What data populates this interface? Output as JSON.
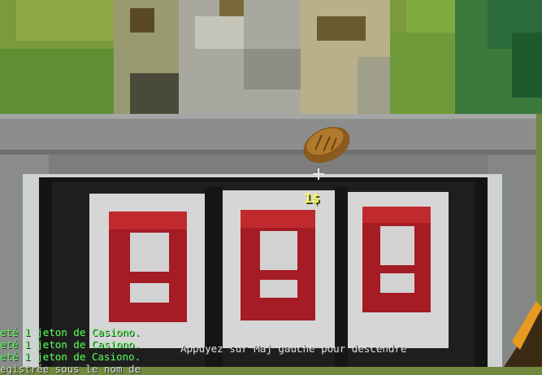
{
  "hud": {
    "price_label": "1$",
    "sneak_hint": "Appuyez sur Maj gauche pour descendre"
  },
  "chat": [
    {
      "text": "eté 1 jeton de Casiono.",
      "color": "#55ff55"
    },
    {
      "text": "eté 1 jeton de Casiono.",
      "color": "#55ff55"
    },
    {
      "text": "eté 1 jeton de Casiono.",
      "color": "#55ff55"
    },
    {
      "text": "egistrée sous le nom de",
      "color": "#d8d8d8"
    }
  ],
  "colors": {
    "reel_red": "#a51c24",
    "reel_white": "#d6d6d6",
    "frame_black": "#1a1a1a",
    "stone": "#8a8c8c",
    "grass": "#5f8f32"
  },
  "icons": {
    "held_item": "bread-icon",
    "crosshair": "crosshair-icon"
  }
}
